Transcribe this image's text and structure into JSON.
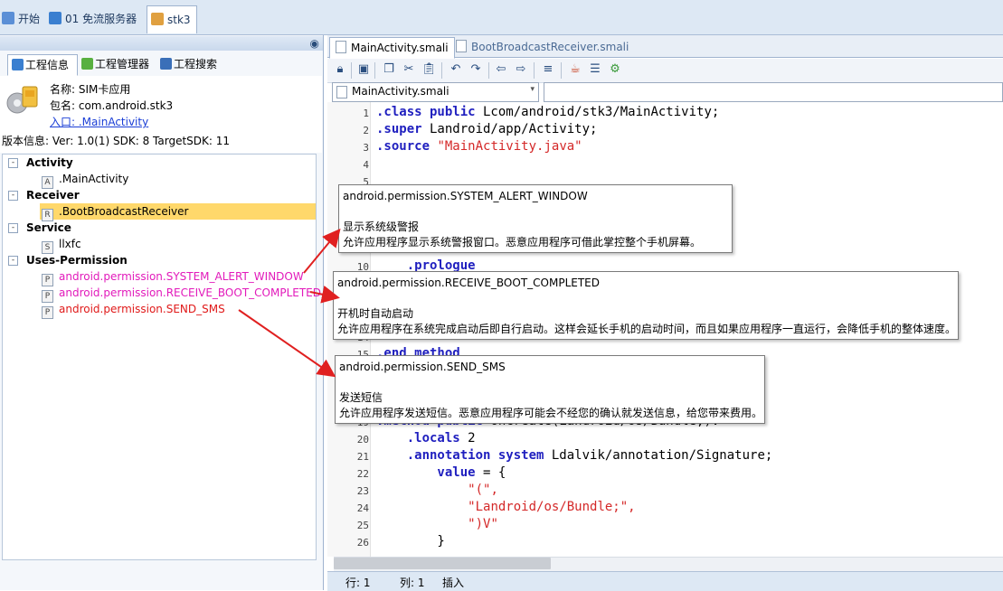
{
  "top_tabs": [
    {
      "label": "开始"
    },
    {
      "label": "01 免流服务器"
    },
    {
      "label": "stk3"
    }
  ],
  "left_tabs": [
    {
      "label": "工程信息"
    },
    {
      "label": "工程管理器"
    },
    {
      "label": "工程搜索"
    }
  ],
  "project_info": {
    "name_label": "名称: SIM卡应用",
    "package_label": "包名: com.android.stk3",
    "entry_label": "入口: .MainActivity",
    "version_label": "版本信息: Ver: 1.0(1) SDK: 8 TargetSDK: 11"
  },
  "tree": {
    "groups": [
      {
        "label": "Activity",
        "toggle": "-",
        "items": [
          {
            "badge": "A",
            "label": ".MainActivity"
          }
        ]
      },
      {
        "label": "Receiver",
        "toggle": "-",
        "items": [
          {
            "badge": "R",
            "label": ".BootBroadcastReceiver",
            "selected": true
          }
        ]
      },
      {
        "label": "Service",
        "toggle": "-",
        "items": [
          {
            "badge": "S",
            "label": "llxfc"
          }
        ]
      },
      {
        "label": "Uses-Permission",
        "toggle": "-",
        "items": [
          {
            "badge": "P",
            "label": "android.permission.SYSTEM_ALERT_WINDOW"
          },
          {
            "badge": "P",
            "label": "android.permission.RECEIVE_BOOT_COMPLETED"
          },
          {
            "badge": "P",
            "label": "android.permission.SEND_SMS"
          }
        ]
      }
    ]
  },
  "editor_tabs": [
    {
      "label": "MainActivity.smali"
    },
    {
      "label": "BootBroadcastReceiver.smali"
    }
  ],
  "file_select": {
    "value": "MainActivity.smali"
  },
  "code_lines": [
    {
      "n": "1",
      "kw": ".class public",
      "rest": " Lcom/android/stk3/MainActivity;",
      "str": ""
    },
    {
      "n": "2",
      "kw": ".super",
      "rest": " Landroid/app/Activity;",
      "str": ""
    },
    {
      "n": "3",
      "kw": ".source",
      "rest": " ",
      "str": "\"MainActivity.java\""
    },
    {
      "n": "4",
      "kw": "",
      "rest": "",
      "str": ""
    },
    {
      "n": "5",
      "kw": "",
      "rest": "",
      "str": ""
    },
    {
      "n": "10",
      "kw": "    .prologue",
      "rest": "",
      "str": ""
    },
    {
      "n": "14",
      "kw": "    return-void",
      "rest": "",
      "str": ""
    },
    {
      "n": "15",
      "kw": ".end method",
      "rest": "",
      "str": ""
    },
    {
      "n": "19",
      "kw": ".method public",
      "rest": " onCreate(Landroid/os/Bundle;)V",
      "str": ""
    },
    {
      "n": "20",
      "kw": "    .locals",
      "rest": " 2",
      "str": ""
    },
    {
      "n": "21",
      "kw": "    .annotation system",
      "rest": " Ldalvik/annotation/Signature;",
      "str": ""
    },
    {
      "n": "22",
      "kw": "        value",
      "rest": " = {",
      "str": ""
    },
    {
      "n": "23",
      "kw": "",
      "rest": "            ",
      "str": "\"(\","
    },
    {
      "n": "24",
      "kw": "",
      "rest": "            ",
      "str": "\"Landroid/os/Bundle;\","
    },
    {
      "n": "25",
      "kw": "",
      "rest": "            ",
      "str": "\")V\""
    },
    {
      "n": "26",
      "kw": "",
      "rest": "        }",
      "str": ""
    }
  ],
  "tooltips": [
    {
      "title": "android.permission.SYSTEM_ALERT_WINDOW",
      "name": "显示系统级警报",
      "desc": "允许应用程序显示系统警报窗口。恶意应用程序可借此掌控整个手机屏幕。"
    },
    {
      "title": "android.permission.RECEIVE_BOOT_COMPLETED",
      "name": "开机时自动启动",
      "desc": "允许应用程序在系统完成启动后即自行启动。这样会延长手机的启动时间，而且如果应用程序一直运行，会降低手机的整体速度。"
    },
    {
      "title": "android.permission.SEND_SMS",
      "name": "发送短信",
      "desc": "允许应用程序发送短信。恶意应用程序可能会不经您的确认就发送信息，给您带来费用。"
    }
  ],
  "status": {
    "row": "行: 1",
    "col": "列: 1",
    "mode": "插入"
  },
  "colors": {
    "permission_pink": "#e21abb",
    "permission_red": "#e01919",
    "arrow": "#e02020",
    "selected_row": "#ffd86b"
  }
}
